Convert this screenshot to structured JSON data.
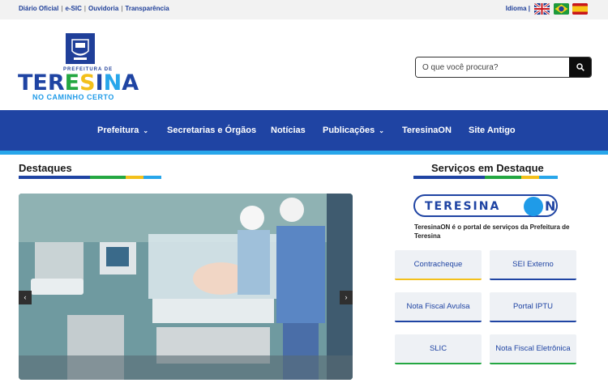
{
  "topbar": {
    "links": [
      "Diário Oficial",
      "e-SIC",
      "Ouvidoria",
      "Transparência"
    ],
    "idioma_label": "Idioma |",
    "flags": [
      "english-flag-icon",
      "portuguese-flag-icon",
      "spanish-flag-icon"
    ]
  },
  "logo": {
    "prefeitura_de": "PREFEITURA DE",
    "word": "TERESINA",
    "tagline": "NO CAMINHO CERTO"
  },
  "search": {
    "placeholder": "O que você procura?"
  },
  "nav": {
    "items": [
      "Prefeitura",
      "Secretarias e Órgãos",
      "Notícias",
      "Publicações",
      "TeresinaON",
      "Site Antigo"
    ]
  },
  "destaques": {
    "title": "Destaques"
  },
  "servicos": {
    "title": "Serviços em Destaque",
    "logo_text": "TERESINA",
    "logo_n": "N",
    "description": "TeresinaON é o portal de serviços da Prefeitura de Teresina",
    "buttons": [
      "Contracheque",
      "SEI Externo",
      "Nota Fiscal Avulsa",
      "Portal IPTU",
      "SLIC",
      "Nota Fiscal Eletrônica"
    ]
  },
  "colors": {
    "primary": "#1f44a3",
    "accent": "#28a6ea",
    "green": "#24a742",
    "yellow": "#f3c01b"
  }
}
